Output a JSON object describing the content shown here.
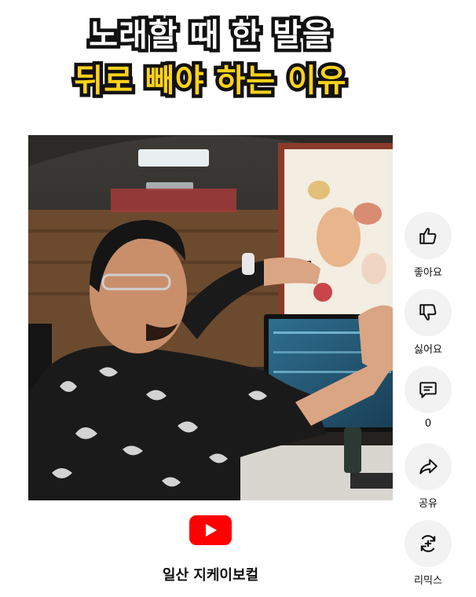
{
  "title_overlay": {
    "line1": "노래할 때 한 발을",
    "line2": "뒤로 빼야 하는 이유"
  },
  "channel": {
    "name": "일산 지케이보컬",
    "logo_icon": "youtube-play-icon",
    "logo_color": "#ff0000"
  },
  "actions": {
    "like": {
      "label": "좋아요",
      "icon": "thumbs-up-icon"
    },
    "dislike": {
      "label": "싫어요",
      "icon": "thumbs-down-icon"
    },
    "comments": {
      "label": "0",
      "icon": "comment-icon"
    },
    "share": {
      "label": "공유",
      "icon": "share-arrow-icon"
    },
    "remix": {
      "label": "리믹스",
      "icon": "remix-icon"
    }
  },
  "colors": {
    "title_white": "#ffffff",
    "title_yellow": "#ffd21a",
    "title_outline": "#111111",
    "action_bg": "#f2f2f2",
    "text": "#0f0f0f"
  }
}
